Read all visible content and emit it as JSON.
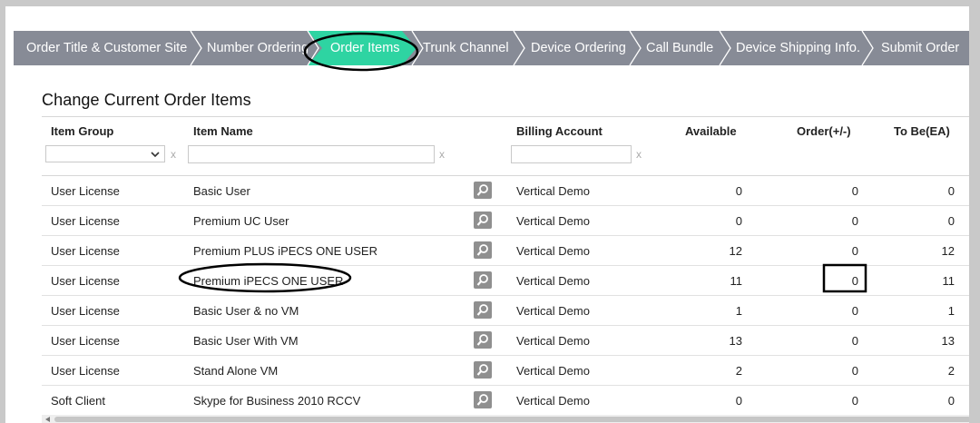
{
  "steps": [
    {
      "label": "Order Title & Customer Site",
      "active": false
    },
    {
      "label": "Number Ordering",
      "active": false
    },
    {
      "label": "Order Items",
      "active": true
    },
    {
      "label": "Trunk Channel",
      "active": false
    },
    {
      "label": "Device Ordering",
      "active": false
    },
    {
      "label": "Call Bundle",
      "active": false
    },
    {
      "label": "Device Shipping Info.",
      "active": false
    },
    {
      "label": "Submit Order",
      "active": false
    }
  ],
  "colors": {
    "step_bg": "#878b96",
    "active_step": "#2ed4a2",
    "annotation": "#000000"
  },
  "page": {
    "title": "Change Current Order Items"
  },
  "table": {
    "headers": {
      "item_group": "Item Group",
      "item_name": "Item Name",
      "billing_account": "Billing Account",
      "available": "Available",
      "order": "Order(+/-)",
      "to_be": "To Be(EA)"
    },
    "filters": {
      "item_group_value": "",
      "item_name_value": "",
      "billing_account_value": "",
      "clear": "x"
    },
    "rows": [
      {
        "group": "User License",
        "name": "Basic User",
        "billing": "Vertical Demo",
        "available": "0",
        "order": "0",
        "to_be": "0"
      },
      {
        "group": "User License",
        "name": "Premium UC User",
        "billing": "Vertical Demo",
        "available": "0",
        "order": "0",
        "to_be": "0"
      },
      {
        "group": "User License",
        "name": "Premium PLUS iPECS ONE USER",
        "billing": "Vertical Demo",
        "available": "12",
        "order": "0",
        "to_be": "12"
      },
      {
        "group": "User License",
        "name": "Premium iPECS ONE USER",
        "billing": "Vertical Demo",
        "available": "11",
        "order": "0",
        "to_be": "11"
      },
      {
        "group": "User License",
        "name": "Basic User & no VM",
        "billing": "Vertical Demo",
        "available": "1",
        "order": "0",
        "to_be": "1"
      },
      {
        "group": "User License",
        "name": "Basic User With VM",
        "billing": "Vertical Demo",
        "available": "13",
        "order": "0",
        "to_be": "13"
      },
      {
        "group": "User License",
        "name": "Stand Alone VM",
        "billing": "Vertical Demo",
        "available": "2",
        "order": "0",
        "to_be": "2"
      },
      {
        "group": "Soft Client",
        "name": "Skype for Business 2010 RCCV",
        "billing": "Vertical Demo",
        "available": "0",
        "order": "0",
        "to_be": "0"
      }
    ]
  }
}
